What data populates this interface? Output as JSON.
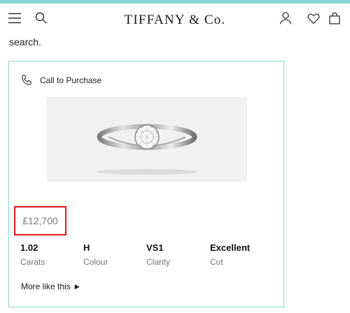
{
  "header": {
    "logo": "TIFFANY & Co.",
    "icons": [
      "menu-icon",
      "search-icon",
      "account-icon",
      "heart-icon",
      "bag-icon"
    ]
  },
  "search_text": "search.",
  "card": {
    "call_label": "Call to Purchase",
    "call_icon": "phone-icon",
    "price": "£12,700",
    "specs": [
      {
        "value": "1.02",
        "label": "Carats"
      },
      {
        "value": "H",
        "label": "Colour"
      },
      {
        "value": "VS1",
        "label": "Clarity"
      },
      {
        "value": "Excellent",
        "label": "Cut"
      }
    ],
    "more_label": "More like this",
    "more_icon": "caret-right-icon"
  },
  "colors": {
    "accent": "#81d8d0",
    "highlight": "#e0191d",
    "muted_text": "#777777"
  }
}
